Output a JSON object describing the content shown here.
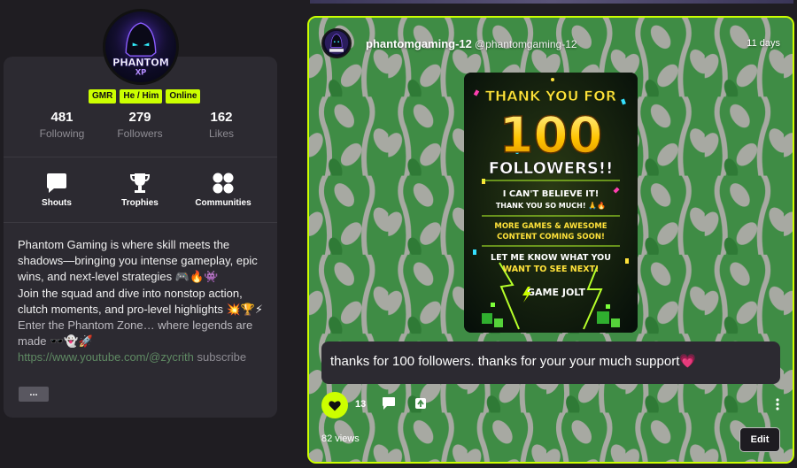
{
  "profile": {
    "avatar_text_top": "PHANTOM",
    "avatar_text_bottom": "XP",
    "badges": [
      "GMR",
      "He / Him",
      "Online"
    ],
    "stats": [
      {
        "value": "481",
        "label": "Following"
      },
      {
        "value": "279",
        "label": "Followers"
      },
      {
        "value": "162",
        "label": "Likes"
      }
    ],
    "nav": [
      {
        "label": "Shouts",
        "icon": "speech-bubble-icon"
      },
      {
        "label": "Trophies",
        "icon": "trophy-icon"
      },
      {
        "label": "Communities",
        "icon": "communities-icon"
      }
    ],
    "bio": {
      "line1": "Phantom Gaming is where skill meets the shadows—bringing you intense gameplay, epic wins, and next-level strategies 🎮🔥👾",
      "line2": "Join the squad and dive into nonstop action, clutch moments, and pro-level highlights 💥🏆⚡",
      "line3": "Enter the Phantom Zone… where legends are made 🕶️👻🚀",
      "link": "https://www.youtube.com/@zycrith",
      "link_suffix": " subscribe"
    },
    "more_label": "..."
  },
  "post": {
    "username": "phantomgaming-12",
    "handle": "@phantomgaming-12",
    "time": "11 days",
    "poster": {
      "l1": "THANK YOU FOR",
      "l2": "100",
      "l3": "FOLLOWERS!!",
      "l4a": "I CAN'T BELIEVE IT!",
      "l4b": "THANK YOU SO MUCH! 🙏🔥",
      "l5a": "MORE GAMES & AWESOME",
      "l5b": "CONTENT COMING SOON!",
      "l6a": "LET ME KNOW WHAT YOU",
      "l6b": "WANT TO SEE NEXT!",
      "brand": "GAME JOLT"
    },
    "caption": "thanks for 100 followers. thanks for your your much support💗",
    "likes": "13",
    "views": "82 views",
    "edit_label": "Edit"
  },
  "colors": {
    "accent": "#ccff00",
    "bg": "#1f1d22",
    "card": "#2c2a31"
  }
}
